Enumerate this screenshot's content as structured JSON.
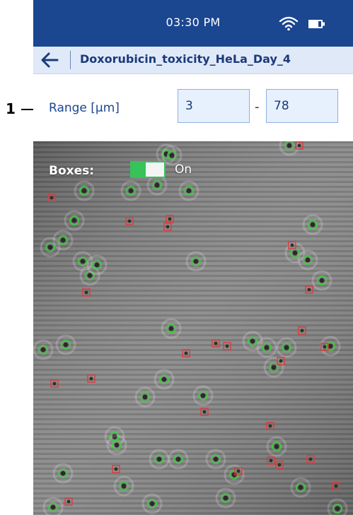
{
  "callout": {
    "number": "1"
  },
  "status_bar": {
    "time": "03:30 PM",
    "wifi_icon": "wifi-icon",
    "battery_icon": "battery-icon"
  },
  "title_bar": {
    "back_icon": "arrow-left-icon",
    "title": "Doxorubicin_toxicity_HeLa_Day_4"
  },
  "range": {
    "label": "Range [μm]",
    "min": "3",
    "separator": "-",
    "max": "78"
  },
  "image_view": {
    "boxes_label": "Boxes:",
    "boxes_state": "On",
    "toggle_on": true,
    "colors": {
      "live_cell": "#3fcf3f",
      "dead_cell": "#e03a3a",
      "toggle": "#35c35a"
    }
  },
  "colors": {
    "status_bar": "#1b4690",
    "title_bar": "#dfe9f8",
    "accent_text": "#1b4690"
  }
}
